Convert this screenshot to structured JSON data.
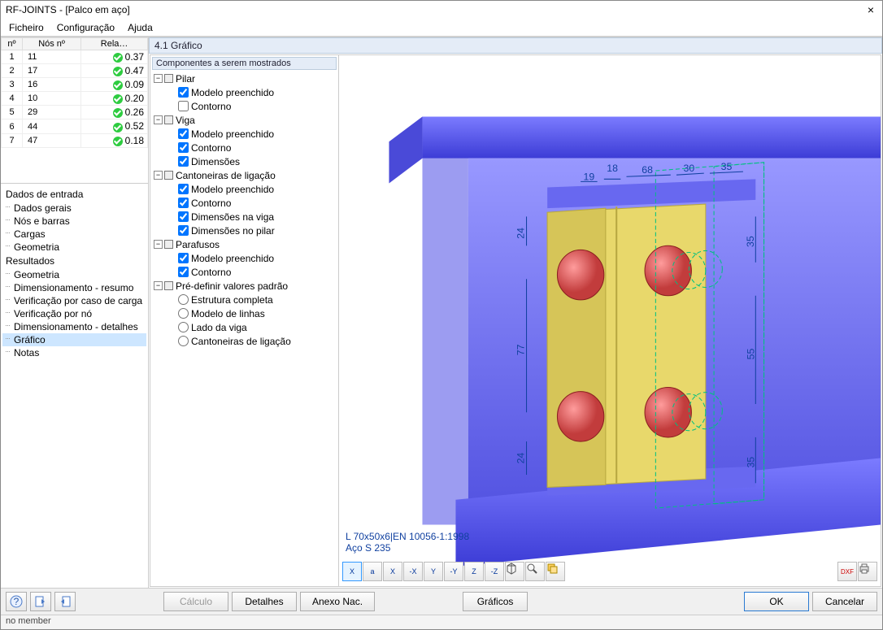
{
  "window": {
    "title": "RF-JOINTS - [Palco em aço]"
  },
  "menu": {
    "file": "Ficheiro",
    "config": "Configuração",
    "help": "Ajuda"
  },
  "table": {
    "headers": {
      "no": "nº",
      "nodes": "Nós nº",
      "ratio": "Rela…"
    },
    "rows": [
      {
        "no": "1",
        "nodes": "11",
        "ratio": "0.37"
      },
      {
        "no": "2",
        "nodes": "17",
        "ratio": "0.47"
      },
      {
        "no": "3",
        "nodes": "16",
        "ratio": "0.09"
      },
      {
        "no": "4",
        "nodes": "10",
        "ratio": "0.20"
      },
      {
        "no": "5",
        "nodes": "29",
        "ratio": "0.26"
      },
      {
        "no": "6",
        "nodes": "44",
        "ratio": "0.52"
      },
      {
        "no": "7",
        "nodes": "47",
        "ratio": "0.18"
      }
    ]
  },
  "nav": {
    "input_group": "Dados de entrada",
    "input_items": [
      "Dados gerais",
      "Nós e barras",
      "Cargas",
      "Geometria"
    ],
    "results_group": "Resultados",
    "results_items": [
      "Geometria",
      "Dimensionamento - resumo",
      "Verificação por caso de carga",
      "Verificação por nó",
      "Dimensionamento - detalhes",
      "Gráfico",
      "Notas"
    ]
  },
  "panel_title": "4.1 Gráfico",
  "tree": {
    "caption": "Componentes a serem mostrados",
    "pilar": {
      "label": "Pilar",
      "modelo": "Modelo preenchido",
      "contorno": "Contorno"
    },
    "viga": {
      "label": "Viga",
      "modelo": "Modelo preenchido",
      "contorno": "Contorno",
      "dim": "Dimensões"
    },
    "cant": {
      "label": "Cantoneiras de ligação",
      "modelo": "Modelo preenchido",
      "contorno": "Contorno",
      "dimv": "Dimensões na viga",
      "dimp": "Dimensões no pilar"
    },
    "paraf": {
      "label": "Parafusos",
      "modelo": "Modelo preenchido",
      "contorno": "Contorno"
    },
    "predef": {
      "label": "Pré-definir valores padrão",
      "estrutura": "Estrutura completa",
      "linhas": "Modelo de linhas",
      "lado": "Lado da viga",
      "cant": "Cantoneiras de ligação"
    }
  },
  "dims": {
    "top1": "19",
    "top2": "18",
    "top3": "68",
    "top4": "30",
    "top5": "35",
    "left1": "24",
    "left2": "77",
    "left3": "24",
    "right1": "35",
    "right2": "55",
    "right3": "35"
  },
  "viewer_info": {
    "profile": "L 70x50x6|EN 10056-1:1998",
    "material": "Aço S 235"
  },
  "footer": {
    "calc": "Cálculo",
    "details": "Detalhes",
    "annex": "Anexo Nac.",
    "graphics": "Gráficos",
    "ok": "OK",
    "cancel": "Cancelar"
  },
  "status": "no member",
  "toolbar_labels": {
    "x": "X",
    "ax": "a",
    "ix": "X",
    "nx": "-X",
    "iy": "Y",
    "ny": "-Y",
    "iz": "Z",
    "nz": "-Z",
    "dxf": "DXF"
  }
}
